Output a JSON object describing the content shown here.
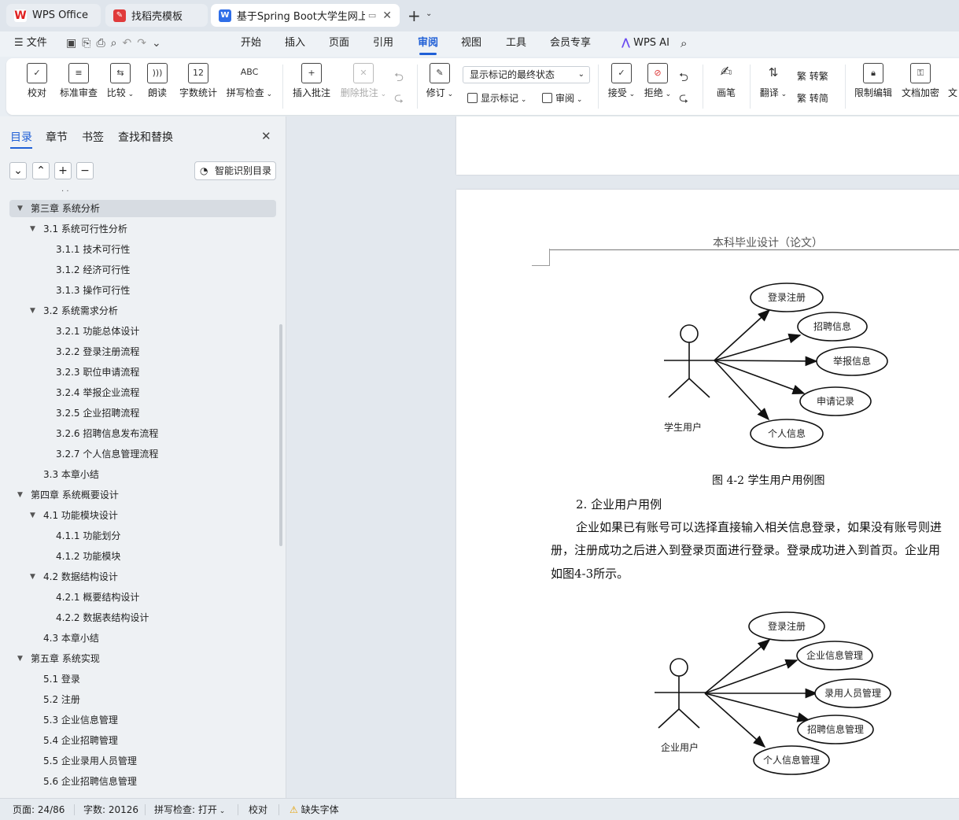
{
  "tabs": [
    {
      "label": "WPS Office",
      "icon": "wps-logo-icon"
    },
    {
      "label": "找稻壳模板",
      "icon": "docer-icon"
    },
    {
      "label": "基于Spring Boot大学生网上",
      "icon": "writer-doc-icon"
    }
  ],
  "menu": {
    "file": "文件",
    "tabs": [
      "开始",
      "插入",
      "页面",
      "引用",
      "审阅",
      "视图",
      "工具",
      "会员专享"
    ],
    "active": "审阅",
    "ai": "WPS AI"
  },
  "ribbon": {
    "proof": "校对",
    "std_review": "标准审查",
    "compare": "比较",
    "read_aloud": "朗读",
    "word_count": "字数统计",
    "spell_check": "拼写检查",
    "insert_comment": "插入批注",
    "delete_comment": "删除批注",
    "revise": "修订",
    "markup_state": "显示标记的最终状态",
    "show_markup": "显示标记",
    "review": "审阅",
    "accept": "接受",
    "reject": "拒绝",
    "pen": "画笔",
    "translate": "翻译",
    "to_traditional": "转繁",
    "to_simplified": "转简",
    "restrict_edit": "限制编辑",
    "doc_encrypt": "文档加密",
    "doc_cut": "文"
  },
  "sidebar": {
    "tabs": [
      "目录",
      "章节",
      "书签",
      "查找和替换"
    ],
    "smart_btn": "智能识别目录",
    "toc": [
      {
        "text": "第三章    系统分析",
        "level": 0,
        "sel": true
      },
      {
        "text": "3.1  系统可行性分析",
        "level": 1
      },
      {
        "text": "3.1.1  技术可行性",
        "level": 2
      },
      {
        "text": "3.1.2  经济可行性",
        "level": 2
      },
      {
        "text": "3.1.3  操作可行性",
        "level": 2
      },
      {
        "text": "3.2  系统需求分析",
        "level": 1
      },
      {
        "text": "3.2.1  功能总体设计",
        "level": 2
      },
      {
        "text": "3.2.2  登录注册流程",
        "level": 2
      },
      {
        "text": "3.2.3  职位申请流程",
        "level": 2
      },
      {
        "text": "3.2.4  举报企业流程",
        "level": 2
      },
      {
        "text": "3.2.5  企业招聘流程",
        "level": 2
      },
      {
        "text": "3.2.6  招聘信息发布流程",
        "level": 2
      },
      {
        "text": "3.2.7  个人信息管理流程",
        "level": 2
      },
      {
        "text": "3.3  本章小结",
        "level": 1,
        "leaf": true
      },
      {
        "text": "第四章    系统概要设计",
        "level": 0
      },
      {
        "text": "4.1  功能模块设计",
        "level": 1
      },
      {
        "text": "4.1.1  功能划分",
        "level": 2
      },
      {
        "text": "4.1.2  功能模块",
        "level": 2
      },
      {
        "text": "4.2  数据结构设计",
        "level": 1
      },
      {
        "text": "4.2.1  概要结构设计",
        "level": 2
      },
      {
        "text": "4.2.2  数据表结构设计",
        "level": 2
      },
      {
        "text": "4.3  本章小结",
        "level": 1,
        "leaf": true
      },
      {
        "text": "第五章    系统实现",
        "level": 0
      },
      {
        "text": "5.1  登录",
        "level": 1,
        "leaf": true
      },
      {
        "text": "5.2  注册",
        "level": 1,
        "leaf": true
      },
      {
        "text": "5.3  企业信息管理",
        "level": 1,
        "leaf": true
      },
      {
        "text": "5.4  企业招聘管理",
        "level": 1,
        "leaf": true
      },
      {
        "text": "5.5  企业录用人员管理",
        "level": 1,
        "leaf": true
      },
      {
        "text": "5.6  企业招聘信息管理",
        "level": 1,
        "leaf": true
      }
    ]
  },
  "doc": {
    "header": "本科毕业设计（论文）",
    "diagram1": {
      "actor": "学生用户",
      "cases": [
        "登录注册",
        "招聘信息",
        "举报信息",
        "申请记录",
        "个人信息"
      ]
    },
    "caption1": "图 4-2 学生用户用例图",
    "item2": "2.  企业用户用例",
    "para_line1": "企业如果已有账号可以选择直接输入相关信息登录，如果没有账号则进",
    "para_line2": "册，注册成功之后进入到登录页面进行登录。登录成功进入到首页。企业用",
    "para_line3": "如图4-3所示。",
    "diagram2": {
      "actor": "企业用户",
      "cases": [
        "登录注册",
        "企业信息管理",
        "录用人员管理",
        "招聘信息管理",
        "个人信息管理"
      ]
    }
  },
  "status": {
    "page": "页面: 24/86",
    "words": "字数: 20126",
    "spell": "拼写检查: 打开",
    "proof": "校对",
    "missing_font": "缺失字体"
  }
}
